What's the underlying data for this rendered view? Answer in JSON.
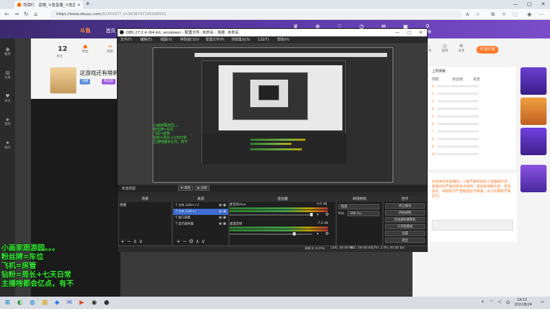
{
  "browser": {
    "tab_title": "阳南叮 - 直播_斗鱼直播_斗鱼直",
    "url_host": "https://www.douyu.com",
    "url_path": "/9130337?_t=3438797165098551",
    "new_tab": "+",
    "minimize": "—",
    "maximize": "□",
    "close": "✕"
  },
  "site": {
    "logo_text": "斗鱼",
    "nav_home": "首页",
    "header_icons": [
      {
        "glyph": "♛",
        "label": "会员"
      },
      {
        "glyph": "⊕",
        "label": "充值"
      },
      {
        "glyph": "♡",
        "label": "关注"
      },
      {
        "glyph": "◷",
        "label": "历史"
      },
      {
        "glyph": "✉",
        "label": "消息"
      },
      {
        "glyph": "▣",
        "label": "下载"
      },
      {
        "glyph": "⚲",
        "label": "开播"
      }
    ],
    "left_sidebar": [
      {
        "glyph": "◉",
        "label": "推荐"
      },
      {
        "glyph": "▤",
        "label": "分类"
      },
      {
        "glyph": "♥",
        "label": "关注"
      },
      {
        "glyph": "◈",
        "label": "游戏"
      },
      {
        "glyph": "★",
        "label": "娱乐"
      }
    ],
    "room": {
      "follow_count": "12",
      "follow_label": "关注",
      "stats": [
        {
          "glyph": "●",
          "label": "粉丝"
        },
        {
          "glyph": "♒",
          "label": "热度"
        }
      ],
      "title": "这游戏还有萌新",
      "tags": [
        {
          "text": "主播",
          "color": "#5b8fe0"
        },
        {
          "text": "粉丝团",
          "color": "#a05be0"
        }
      ]
    },
    "right_panel": {
      "stats": [
        {
          "glyph": "♨",
          "label": "任务"
        },
        {
          "glyph": "◎",
          "label": "签到"
        },
        {
          "glyph": "❀",
          "label": "分享"
        }
      ],
      "pc_button": "PC客户端",
      "rank_title": "上周贡献",
      "rank_tabs": [
        "周榜",
        "粉丝榜",
        "贵宾"
      ],
      "rank_rows": [
        "1",
        "2",
        "3",
        "4",
        "5",
        "6",
        "7",
        "8",
        "9",
        "10"
      ],
      "chat_text": "欢迎来到本直播间，斗鱼严禁未成年人直播或打赏。直播间内严禁出现违法违规、低俗色情等内容，若有违反，将视情节严重程度给予禁播、永久封禁账号等处罚。"
    }
  },
  "overlay": {
    "lines": [
      "小画家跟游园。。。",
      "粉丝牌=车位",
      "飞机=房管",
      "钻粉=周长+七天日常",
      "主播啥都会亿点，有不"
    ]
  },
  "obs": {
    "title": "OBS 27.2.4 (64-bit, windows) - 配置文件: 未命名 - 场景: 未命名",
    "menu": [
      "文件(F)",
      "编辑(E)",
      "视图(V)",
      "停靠窗口(D)",
      "配置文件(P)",
      "场景集合(S)",
      "工具(T)",
      "帮助(H)"
    ],
    "scene_top_label": "未选择源",
    "filters_btn": "⚙ 属性",
    "props_btn": "◐ 滤镜",
    "docks": {
      "scenes": "场景",
      "sources": "来源",
      "mixer": "混音器",
      "transitions": "转场特效",
      "controls": "控件"
    },
    "scene_item": "场景",
    "sources": [
      {
        "name": "文本 (GDI+) 2",
        "selected": false
      },
      {
        "name": "文本 (GDI+)",
        "selected": true
      },
      {
        "name": "窗口采集",
        "selected": false
      },
      {
        "name": "显示器采集",
        "selected": false
      }
    ],
    "mixer": [
      {
        "name": "麦克风/Aux",
        "db": "0.0 dB"
      },
      {
        "name": "桌面音频",
        "db": "-7.0 dB"
      }
    ],
    "transition": {
      "type": "渐变",
      "duration_label": "时长",
      "duration": "300 ms"
    },
    "controls": [
      "停止推流",
      "开始录制",
      "启动虚拟摄像机",
      "工作室模式",
      "设置",
      "退出"
    ],
    "status": {
      "dropped": "丢帧 0 (0.0%)",
      "live": "LIVE: 00:00:00",
      "rec": "REC: 00:00:00",
      "cpu": "CPU: 2.4%, 60.00 fps"
    },
    "nested_text": "小画家跟游园。。。\n粉丝牌=车位\n飞机=房管\n钻粉=周长+七天日常\n主播啥都会亿点，有不"
  },
  "taskbar": {
    "apps": [
      {
        "glyph": "⊞",
        "color": "#0078d4"
      },
      {
        "glyph": "◐",
        "color": "#1d9c3c"
      },
      {
        "glyph": "◍",
        "color": "#0a84d6"
      },
      {
        "glyph": "▦",
        "color": "#d8a31a"
      },
      {
        "glyph": "◆",
        "color": "#2e7be6"
      },
      {
        "glyph": "✉",
        "color": "#3a64d8"
      },
      {
        "glyph": "▶",
        "color": "#e24a2b"
      },
      {
        "glyph": "◉",
        "color": "#222"
      },
      {
        "glyph": "●",
        "color": "#333"
      }
    ],
    "time": "19:13",
    "date": "2022/8/24"
  }
}
